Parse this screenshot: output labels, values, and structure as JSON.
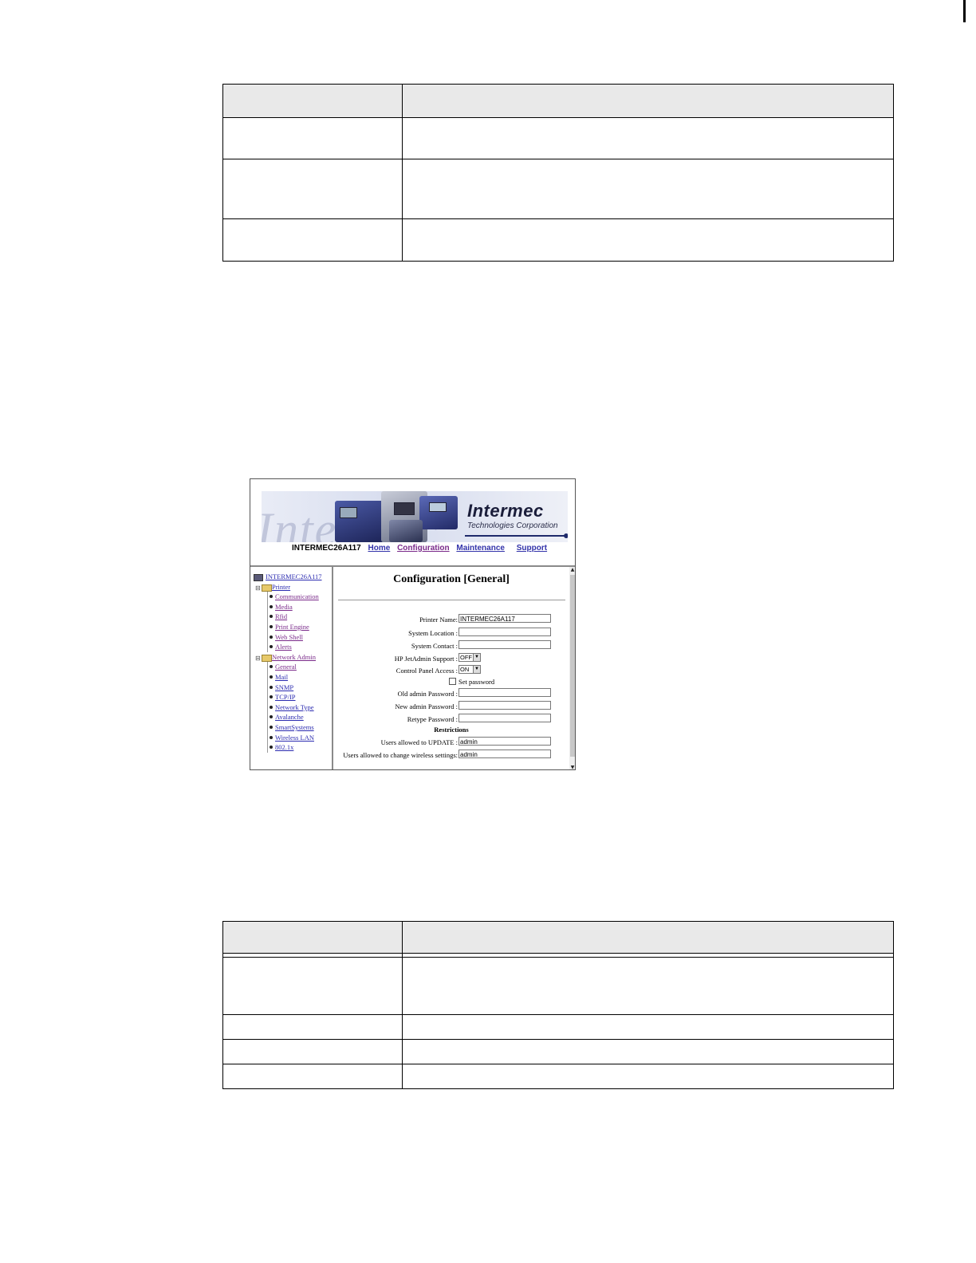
{
  "table_1": {
    "rows": 4
  },
  "table_2": {
    "rows": 5
  },
  "screenshot": {
    "banner": {
      "watermark": "Intermec",
      "brand": "Intermec",
      "tagline": "Technologies Corporation"
    },
    "nav": {
      "host": "INTERMEC26A117",
      "links": [
        "Home",
        "Configuration",
        "Maintenance",
        "Support"
      ]
    },
    "tree": {
      "root": "INTERMEC26A117",
      "printer_folder": "Printer",
      "printer_items": [
        "Communication",
        "Media",
        "Rfid",
        "Print Engine",
        "Web Shell",
        "Alerts"
      ],
      "network_folder": "Network Admin",
      "network_items": [
        "General",
        "Mail",
        "SNMP",
        "TCP/IP",
        "Network Type",
        "Avalanche",
        "SmartSystems",
        "Wireless LAN",
        "802.1x"
      ]
    },
    "form": {
      "title": "Configuration [General]",
      "printer_name_label": "Printer Name:",
      "printer_name_value": "INTERMEC26A117",
      "system_location_label": "System Location :",
      "system_location_value": "",
      "system_contact_label": "System Contact :",
      "system_contact_value": "",
      "hp_jetadmin_label": "HP JetAdmin Support :",
      "hp_jetadmin_value": "OFF",
      "control_panel_label": "Control Panel Access :",
      "control_panel_value": "ON",
      "set_password_label": "Set password",
      "old_password_label": "Old admin Password :",
      "new_password_label": "New admin Password :",
      "retype_password_label": "Retype Password :",
      "restrictions_heading": "Restrictions",
      "update_users_label": "Users allowed to UPDATE :",
      "update_users_value": "admin",
      "wireless_users_label": "Users allowed to change wireless settings:",
      "wireless_users_value": "admin"
    }
  }
}
